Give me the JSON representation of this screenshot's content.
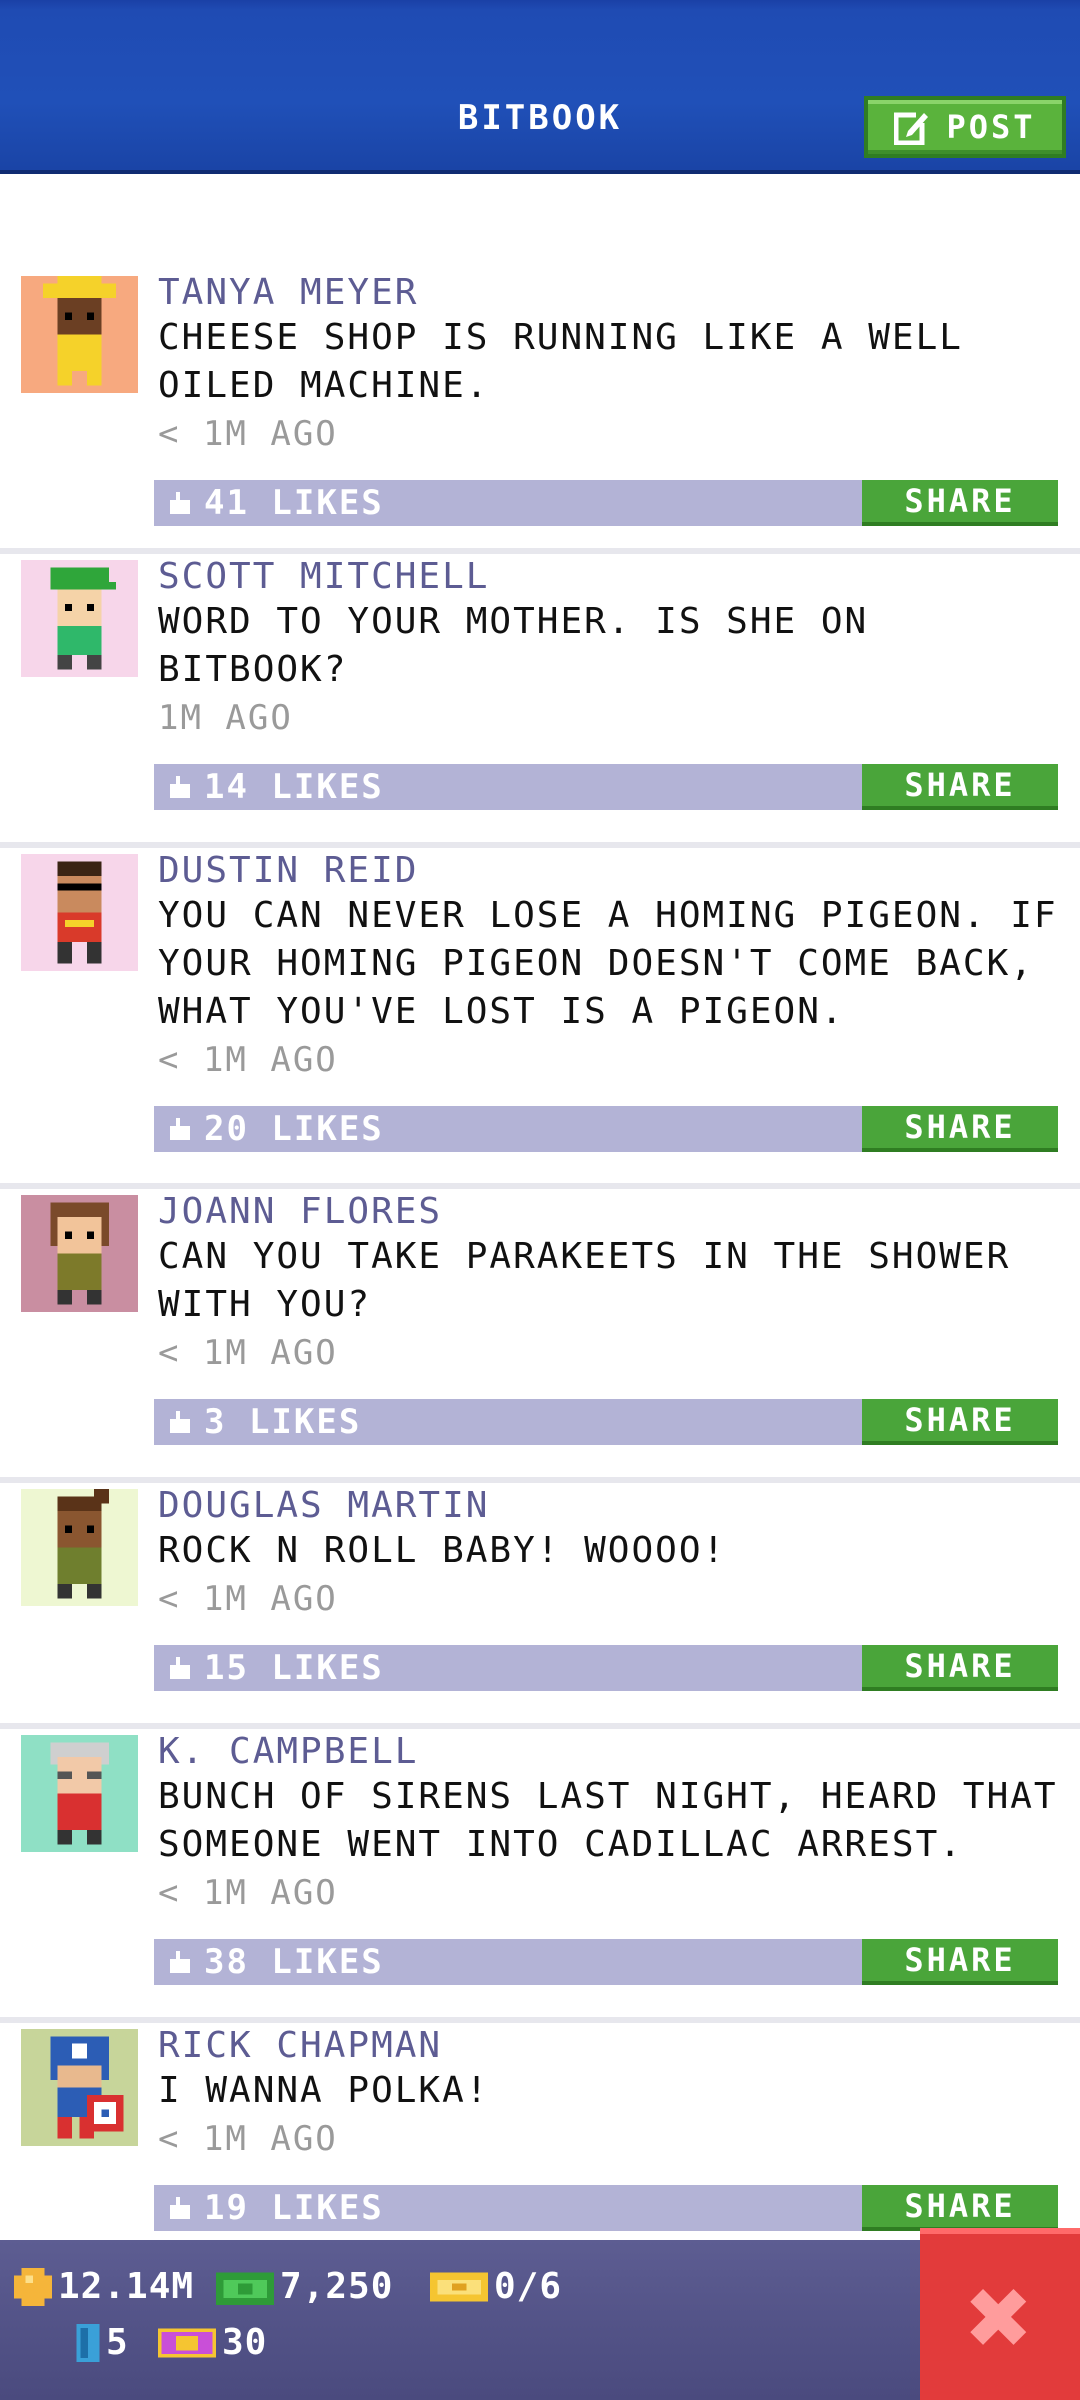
{
  "header": {
    "title": "BITBOOK",
    "post_label": "POST"
  },
  "posts": [
    {
      "author": "TANYA MEYER",
      "text": "CHEESE SHOP IS RUNNING LIKE A WELL OILED MACHINE.",
      "time": "< 1M AGO",
      "likes": "41 LIKES",
      "share": "SHARE",
      "avatar_bg": "#f7a97f"
    },
    {
      "author": "SCOTT MITCHELL",
      "text": "WORD TO YOUR MOTHER. IS SHE ON BITBOOK?",
      "time": "1M AGO",
      "likes": "14 LIKES",
      "share": "SHARE",
      "avatar_bg": "#f7d6ea"
    },
    {
      "author": "DUSTIN REID",
      "text": "YOU CAN NEVER LOSE A HOMING PIGEON. IF YOUR HOMING PIGEON DOESN'T COME BACK, WHAT YOU'VE LOST IS A PIGEON.",
      "time": "< 1M AGO",
      "likes": "20 LIKES",
      "share": "SHARE",
      "avatar_bg": "#f7d6ea"
    },
    {
      "author": "JOANN FLORES",
      "text": "CAN YOU TAKE PARAKEETS IN THE SHOWER WITH YOU?",
      "time": "< 1M AGO",
      "likes": "3 LIKES",
      "share": "SHARE",
      "avatar_bg": "#c98ea1"
    },
    {
      "author": "DOUGLAS MARTIN",
      "text": "ROCK N ROLL BABY! WOOOO!",
      "time": "< 1M AGO",
      "likes": "15 LIKES",
      "share": "SHARE",
      "avatar_bg": "#eef7d2"
    },
    {
      "author": "K. CAMPBELL",
      "text": "BUNCH OF SIRENS LAST NIGHT, HEARD THAT SOMEONE WENT INTO CADILLAC ARREST.",
      "time": "< 1M AGO",
      "likes": "38 LIKES",
      "share": "SHARE",
      "avatar_bg": "#8fe0c5"
    },
    {
      "author": "RICK CHAPMAN",
      "text": "I WANNA POLKA!",
      "time": "< 1M AGO",
      "likes": "19 LIKES",
      "share": "SHARE",
      "avatar_bg": "#c7d59a"
    }
  ],
  "status": {
    "coins": "12.14M",
    "bux": "7,250",
    "tickets": "0/6",
    "level": "5",
    "vip": "30"
  },
  "colors": {
    "header_blue": "#1f4bb3",
    "post_green": "#5ab33c",
    "like_bar": "#b3b3d6",
    "author_purple": "#5d5c93",
    "close_red": "#e23b3b"
  }
}
